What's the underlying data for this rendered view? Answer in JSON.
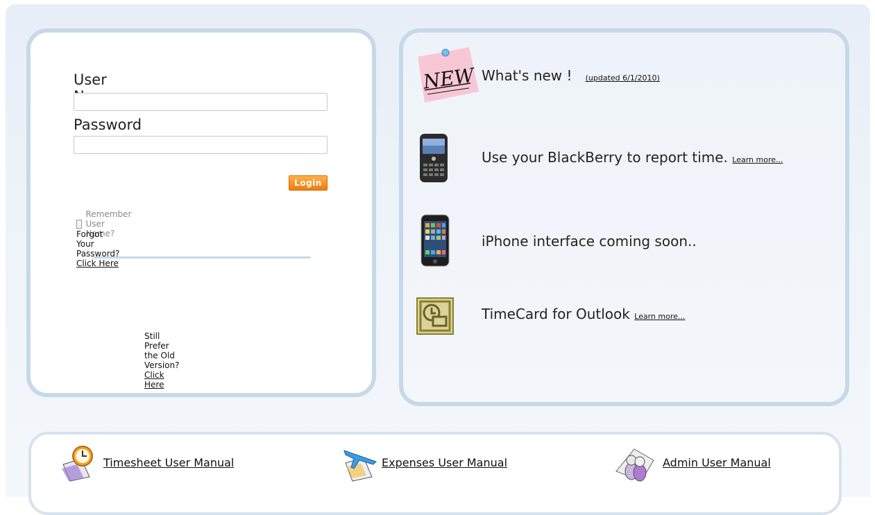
{
  "login": {
    "user_label": "User Name",
    "password_label": "Password",
    "user_value": "",
    "password_value": "",
    "login_button": "Login",
    "remember_label": "Remember User Name?",
    "forgot_text": "Forgot Your Password?",
    "forgot_link": "Click Here",
    "old_version_text": "Still Prefer the Old Version?",
    "old_version_link": "Click Here"
  },
  "info": {
    "whats_new": "What's new !",
    "whats_new_updated": "(updated 6/1/2010)",
    "blackberry_text": "Use your BlackBerry to report time.",
    "blackberry_link": "Learn more...",
    "iphone_text": "iPhone interface coming soon..",
    "outlook_text": "TimeCard for Outlook",
    "outlook_link": "Learn more...",
    "new_badge": "NEW"
  },
  "manuals": {
    "timesheet": "Timesheet User Manual",
    "expenses": "Expenses User Manual",
    "admin": "Admin User Manual"
  },
  "colors": {
    "panel_border": "#c6d9e8",
    "login_button": "#f07a0c"
  },
  "icons": [
    "new-sticky-note-icon",
    "blackberry-phone-icon",
    "iphone-icon",
    "outlook-icon",
    "clock-icon",
    "airplane-icon",
    "admin-users-icon"
  ]
}
